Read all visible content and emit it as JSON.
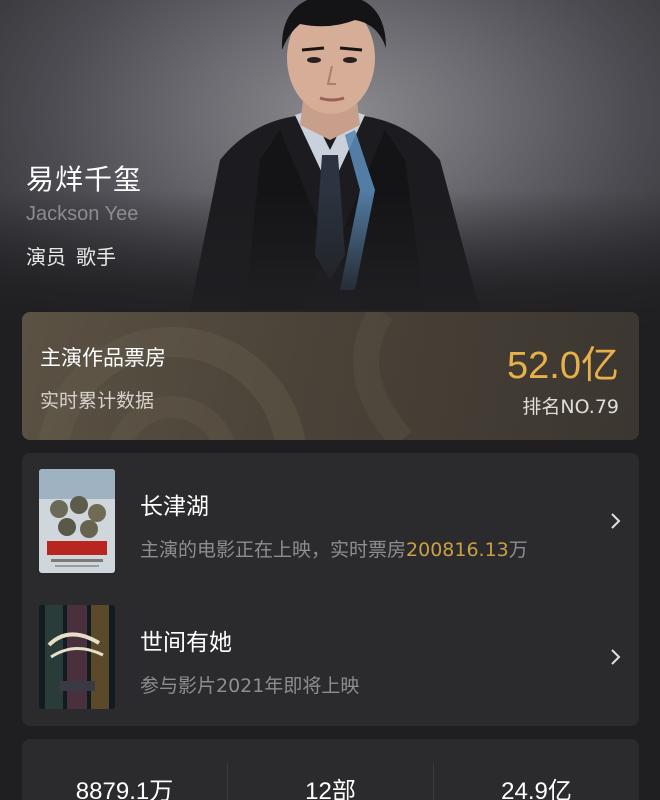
{
  "profile": {
    "name_cn": "易烊千玺",
    "name_en": "Jackson Yee",
    "roles": [
      "演员",
      "歌手"
    ]
  },
  "box_office": {
    "title": "主演作品票房",
    "subtitle": "实时累计数据",
    "value": "52.0亿",
    "rank": "排名NO.79"
  },
  "films": [
    {
      "title": "长津湖",
      "desc_prefix": "主演的电影正在上映，实时票房",
      "desc_highlight": "200816.13",
      "desc_suffix": "万",
      "poster_icon": "poster-changjin-lake"
    },
    {
      "title": "世间有她",
      "desc_prefix": "参与影片2021年即将上映",
      "desc_highlight": "",
      "desc_suffix": "",
      "poster_icon": "poster-shijian-youta"
    }
  ],
  "stats": [
    "8879.1万",
    "12部",
    "24.9亿"
  ],
  "colors": {
    "background": "#1f1f22",
    "card": "#2b2b2e",
    "gold": "#e6b04a",
    "gold_text": "#c9a043",
    "muted": "#8e8e92"
  }
}
